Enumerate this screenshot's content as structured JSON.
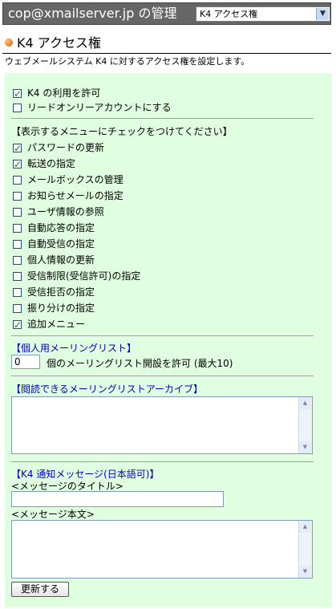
{
  "header": {
    "title": "cop@xmailserver.jp の管理",
    "select_value": "K4 アクセス権"
  },
  "section": {
    "title": "K4 アクセス権",
    "description": "ウェブメールシステム K4 に対するアクセス権を設定します。"
  },
  "options": [
    {
      "label": "K4 の利用を許可",
      "checked": true
    },
    {
      "label": "リードオンリーアカウントにする",
      "checked": false
    }
  ],
  "menu_header": "【表示するメニューにチェックをつけてください】",
  "menu_items": [
    {
      "label": "パスワードの更新",
      "checked": true
    },
    {
      "label": "転送の指定",
      "checked": true
    },
    {
      "label": "メールボックスの管理",
      "checked": false
    },
    {
      "label": "お知らせメールの指定",
      "checked": false
    },
    {
      "label": "ユーザ情報の参照",
      "checked": false
    },
    {
      "label": "自動応答の指定",
      "checked": false
    },
    {
      "label": "自動受信の指定",
      "checked": false
    },
    {
      "label": "個人情報の更新",
      "checked": false
    },
    {
      "label": "受信制限(受信許可)の指定",
      "checked": false
    },
    {
      "label": "受信拒否の指定",
      "checked": false
    },
    {
      "label": "振り分けの指定",
      "checked": false
    },
    {
      "label": "追加メニュー",
      "checked": true
    }
  ],
  "mailing_list": {
    "header": "【個人用メーリングリスト】",
    "count_value": "0",
    "count_label": "個のメーリングリスト開設を許可 (最大10)"
  },
  "archive": {
    "header": "【閲読できるメーリングリストアーカイブ】"
  },
  "notification": {
    "header": "【K4 通知メッセージ(日本語可)】",
    "title_label": "<メッセージのタイトル>",
    "body_label": "<メッセージ本文>"
  },
  "submit_label": "更新する"
}
